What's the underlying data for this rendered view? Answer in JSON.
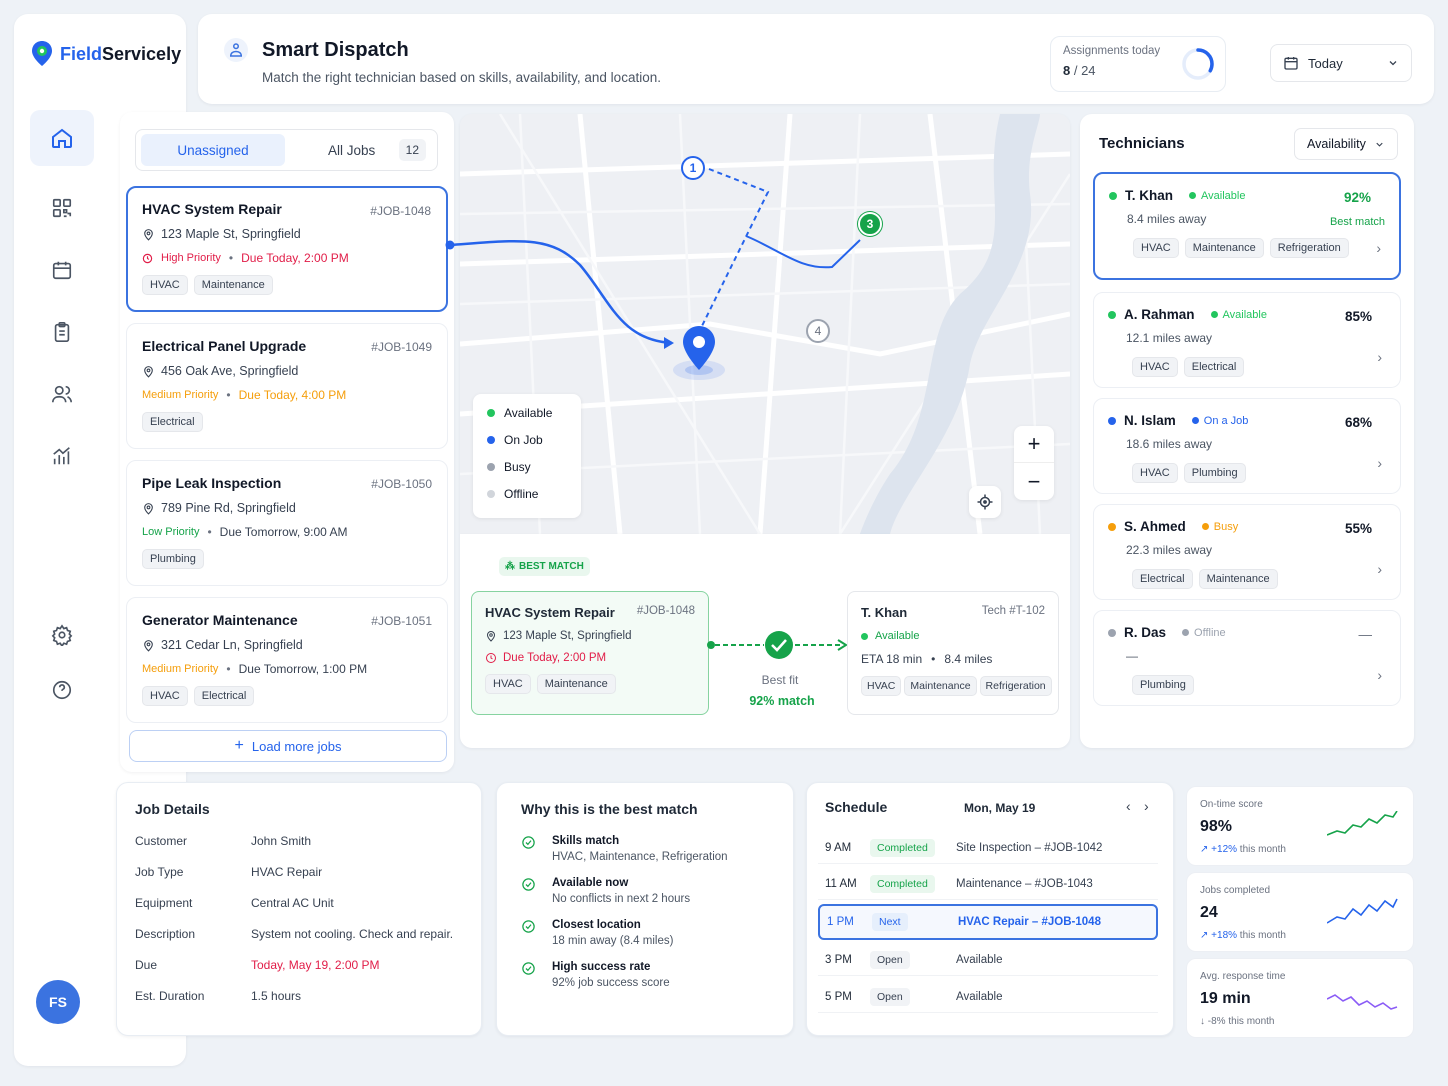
{
  "brand": {
    "name_part1": "Field",
    "name_part2": "Servicely",
    "accent": "#2563eb"
  },
  "header": {
    "title": "Smart Dispatch",
    "subtitle": "Match the right technician based on skills, availability, and location.",
    "assign_label": "Assignments today",
    "assign_done": "8",
    "assign_total": " / 24",
    "assign_progress": 0.33,
    "date_select": "Today"
  },
  "sidebar": {
    "items": [
      "home-icon",
      "grid-icon",
      "calendar-icon",
      "clipboard-icon",
      "users-icon",
      "chart-icon"
    ],
    "bottom": [
      "settings-icon",
      "help-icon"
    ],
    "avatar": "FS"
  },
  "jobs": {
    "tab_unassigned": "Unassigned",
    "tab_all": "All Jobs",
    "tab_all_count": "12",
    "items": [
      {
        "title": "HVAC System Repair",
        "id": "#JOB-1048",
        "addr": "123 Maple St, Springfield",
        "priority": "High Priority",
        "pcolor": "#e11d48",
        "due": "Due Today, 2:00 PM",
        "dcolor": "#e11d48",
        "tags": [
          "HVAC",
          "Maintenance"
        ]
      },
      {
        "title": "Electrical Panel Upgrade",
        "id": "#JOB-1049",
        "addr": "456 Oak Ave, Springfield",
        "priority": "Medium Priority",
        "pcolor": "#f59e0b",
        "due": "Due Today, 4:00 PM",
        "dcolor": "#f59e0b",
        "tags": [
          "Electrical"
        ]
      },
      {
        "title": "Pipe Leak Inspection",
        "id": "#JOB-1050",
        "addr": "789 Pine Rd, Springfield",
        "priority": "Low Priority",
        "pcolor": "#16a34a",
        "due": "Due Tomorrow, 9:00 AM",
        "dcolor": "#374151",
        "tags": [
          "Plumbing"
        ]
      },
      {
        "title": "Generator Maintenance",
        "id": "#JOB-1051",
        "addr": "321 Cedar Ln, Springfield",
        "priority": "Medium Priority",
        "pcolor": "#f59e0b",
        "due": "Due Tomorrow, 1:00 PM",
        "dcolor": "#374151",
        "tags": [
          "HVAC",
          "Electrical"
        ]
      }
    ],
    "load_more": "Load more jobs"
  },
  "map": {
    "markers": [
      "1",
      "3",
      "4"
    ],
    "legend": [
      "Available",
      "On Job",
      "Busy",
      "Offline"
    ],
    "legend_colors": [
      "#22c55e",
      "#2563eb",
      "#9ca3af",
      "#d1d5db"
    ],
    "zoom_in": "+",
    "zoom_out": "−"
  },
  "match": {
    "badge": "BEST MATCH",
    "job": {
      "title": "HVAC System Repair",
      "id": "#JOB-1048",
      "addr": "123 Maple St, Springfield",
      "due": "Due Today, 2:00 PM",
      "tags": [
        "HVAC",
        "Maintenance"
      ]
    },
    "fit_label": "Best fit",
    "fit_value": "92% match",
    "tech": {
      "name": "T. Khan",
      "id": "Tech #T-102",
      "status": "Available",
      "eta": "ETA 18 min",
      "dist": "8.4 miles",
      "tags": [
        "HVAC",
        "Maintenance",
        "Refrigeration"
      ]
    }
  },
  "technicians": {
    "title": "Technicians",
    "filter": "Availability",
    "items": [
      {
        "name": "T. Khan",
        "status": "Available",
        "scolor": "#22c55e",
        "pct": "92%",
        "dist": "8.4 miles away",
        "note": "Best match",
        "tags": [
          "HVAC",
          "Maintenance",
          "Refrigeration"
        ]
      },
      {
        "name": "A. Rahman",
        "status": "Available",
        "scolor": "#22c55e",
        "pct": "85%",
        "dist": "12.1 miles away",
        "tags": [
          "HVAC",
          "Electrical"
        ]
      },
      {
        "name": "N. Islam",
        "status": "On a Job",
        "scolor": "#2563eb",
        "pct": "68%",
        "dist": "18.6 miles away",
        "tags": [
          "HVAC",
          "Plumbing"
        ]
      },
      {
        "name": "S. Ahmed",
        "status": "Busy",
        "scolor": "#f59e0b",
        "pct": "55%",
        "dist": "22.3 miles away",
        "tags": [
          "Electrical",
          "Maintenance"
        ]
      },
      {
        "name": "R. Das",
        "status": "Offline",
        "scolor": "#9ca3af",
        "pct": "—",
        "dist": "—",
        "tags": [
          "Plumbing"
        ]
      }
    ]
  },
  "details": {
    "title": "Job Details",
    "rows": [
      {
        "k": "Customer",
        "v": "John Smith"
      },
      {
        "k": "Job Type",
        "v": "HVAC Repair"
      },
      {
        "k": "Equipment",
        "v": "Central AC Unit"
      },
      {
        "k": "Description",
        "v": "System not cooling. Check and repair."
      },
      {
        "k": "Due",
        "v": "Today, May 19, 2:00 PM"
      },
      {
        "k": "Est. Duration",
        "v": "1.5 hours"
      }
    ]
  },
  "why": {
    "title": "Why this is the best match",
    "items": [
      {
        "t": "Skills match",
        "d": "HVAC, Maintenance, Refrigeration"
      },
      {
        "t": "Available now",
        "d": "No conflicts in next 2 hours"
      },
      {
        "t": "Closest location",
        "d": "18 min away (8.4 miles)"
      },
      {
        "t": "High success rate",
        "d": "92% job success score"
      }
    ]
  },
  "schedule": {
    "title": "Schedule",
    "date": "Mon, May 19",
    "rows": [
      {
        "time": "9 AM",
        "status": "Completed",
        "text": "Site Inspection – #JOB-1042"
      },
      {
        "time": "11 AM",
        "status": "Completed",
        "text": "Maintenance – #JOB-1043"
      },
      {
        "time": "1 PM",
        "status": "Next",
        "text": "HVAC Repair – #JOB-1048"
      },
      {
        "time": "3 PM",
        "status": "Open",
        "text": "Available"
      },
      {
        "time": "5 PM",
        "status": "Open",
        "text": "Available"
      }
    ]
  },
  "kpis": [
    {
      "label": "On-time score",
      "value": "98%",
      "change": "+12%",
      "suffix": " this month",
      "color": "#16a34a"
    },
    {
      "label": "Jobs completed",
      "value": "24",
      "change": "+18%",
      "suffix": " this month",
      "color": "#2563eb"
    },
    {
      "label": "Avg. response time",
      "value": "19 min",
      "change": "-8%",
      "suffix": " this month",
      "color": "#8b5cf6"
    }
  ]
}
